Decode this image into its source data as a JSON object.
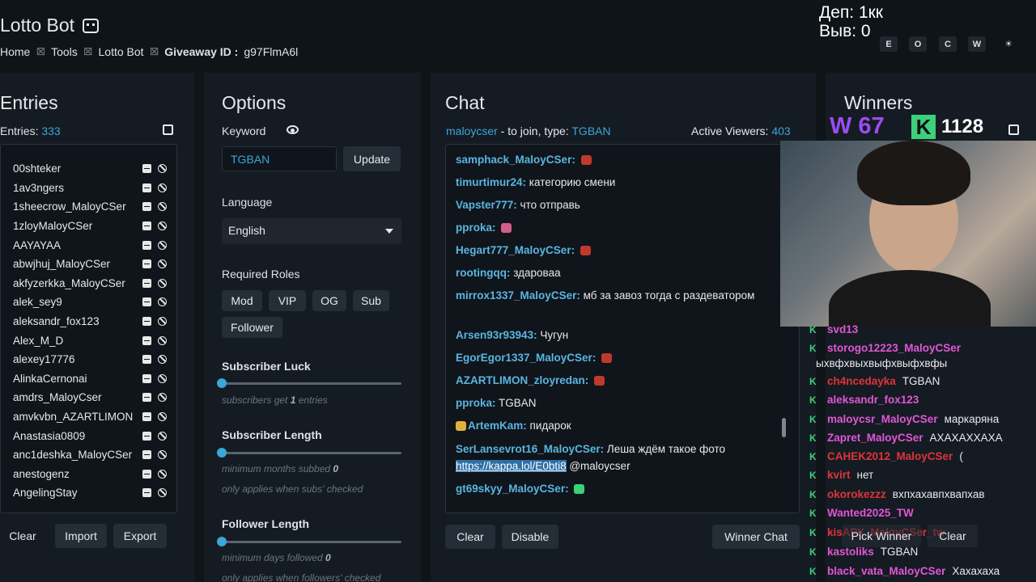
{
  "header": {
    "title": "Lotto Bot",
    "breadcrumbs": [
      "Home",
      "Tools",
      "Lotto Bot"
    ],
    "giveaway_label": "Giveaway ID :",
    "giveaway_id": "g97FlmA6l",
    "overlay_line1": "Деп: 1кк",
    "overlay_line2": "Выв: 0",
    "buttons": [
      "E",
      "O",
      "C",
      "W",
      "☀"
    ]
  },
  "entries": {
    "title": "Entries",
    "count_label": "Entries:",
    "count": "333",
    "items": [
      "00shteker",
      "1av3ngers",
      "1sheecrow_MaloyCSer",
      "1zloyMaloyCSer",
      "AAYAYAA",
      "abwjhuj_MaloyCSer",
      "akfyzerkka_MaloyCSer",
      "alek_sey9",
      "aleksandr_fox123",
      "Alex_M_D",
      "alexey17776",
      "AlinkaCernonai",
      "amdrs_MaloyCser",
      "amvkvbn_AZARTLIMON",
      "Anastasia0809",
      "anc1deshka_MaloyCSer",
      "anestogenz",
      "AngelingStay"
    ],
    "clear": "Clear",
    "import": "Import",
    "export": "Export"
  },
  "options": {
    "title": "Options",
    "keyword_label": "Keyword",
    "keyword_value": "TGBAN",
    "update": "Update",
    "language_label": "Language",
    "language_value": "English",
    "roles_label": "Required Roles",
    "roles": [
      "Mod",
      "VIP",
      "OG",
      "Sub",
      "Follower"
    ],
    "sub_luck_label": "Subscriber Luck",
    "sub_luck_hint_a": "subscribers get ",
    "sub_luck_hint_b": "1",
    "sub_luck_hint_c": " entries",
    "sub_length_label": "Subscriber Length",
    "sub_length_hint_a": "minimum months subbed ",
    "sub_length_hint_b": "0",
    "sub_length_hint2": "only applies when subs' checked",
    "fol_length_label": "Follower Length",
    "fol_length_hint_a": "minimum days followed ",
    "fol_length_hint_b": "0",
    "fol_length_hint2": "only applies when followers' checked"
  },
  "chat": {
    "title": "Chat",
    "channel": "maloycser",
    "join_text": " - to join, type: ",
    "join_keyword": "TGBAN",
    "viewers_label": "Active Viewers:",
    "viewers": "403",
    "messages": [
      {
        "user": "samphack_MaloyCSer:",
        "text": ""
      },
      {
        "user": "timurtimur24:",
        "text": "категорию смени"
      },
      {
        "user": "Vapster777:",
        "text": "что отправь"
      },
      {
        "user": "pproka:",
        "text": ""
      },
      {
        "user": "Hegart777_MaloyCSer:",
        "text": ""
      },
      {
        "user": "rootingqq:",
        "text": "здароваа"
      },
      {
        "user": "mirrox1337_MaloyCSer:",
        "text": "мб за завоз тогда с раздеватором"
      },
      {
        "user": "Arsen93r93943:",
        "text": "Чугун"
      },
      {
        "user": "EgorEgor1337_MaloyCSer:",
        "text": ""
      },
      {
        "user": "AZARTLIMON_zloyredan:",
        "text": ""
      },
      {
        "user": "pproka:",
        "text": "TGBAN"
      },
      {
        "user": "ArtemKam:",
        "text": "пидарок"
      },
      {
        "user": "SerLansevrot16_MaloyCSer:",
        "text": "Леша ждём такое фото"
      },
      {
        "user": "gt69skyy_MaloyCSer:",
        "text": ""
      }
    ],
    "link": "https://kappa.lol/E0bti8",
    "link_after": " @maloycser",
    "clear": "Clear",
    "disable": "Disable",
    "winner_chat": "Winner Chat"
  },
  "winners": {
    "title": "Winners",
    "overlay_w": "W 67",
    "overlay_k_icon": "K",
    "overlay_num": "1128",
    "rows": [
      {
        "user": "svd13",
        "text": "",
        "c": "pink"
      },
      {
        "user": "storogo12223_MaloyCSer",
        "text": "",
        "c": "pink"
      },
      {
        "user": "",
        "text": "ыхвфхвыхвыфхвыфхвфы",
        "c": "pink"
      },
      {
        "user": "ch4ncedayka",
        "text": "TGBAN",
        "c": "red"
      },
      {
        "user": "aleksandr_fox123",
        "text": "",
        "c": "pink"
      },
      {
        "user": "maloycsr_MaloyCSer",
        "text": "маркаряна",
        "c": "pink"
      },
      {
        "user": "Zapret_MaloyCSer",
        "text": "АХАХАХХАХА",
        "c": "pink"
      },
      {
        "user": "CAHEK2012_MaloyCSer",
        "text": "(",
        "c": "red"
      },
      {
        "user": "kvirt",
        "text": "нет",
        "c": "red"
      },
      {
        "user": "okorokezzz",
        "text": "вхпхахавпхвапхав",
        "c": "red"
      },
      {
        "user": "Wanted2025_TW",
        "text": "",
        "c": "pink"
      },
      {
        "user": "kisАРК_MaloyCSer_tw",
        "text": "",
        "c": "red"
      },
      {
        "user": "kastoliks",
        "text": "TGBAN",
        "c": "pink"
      },
      {
        "user": "black_vata_MaloyCSer",
        "text": "Хахахаха",
        "c": "pink"
      }
    ],
    "pick_winner": "Pick Winner",
    "clear": "Clear"
  },
  "colors": {
    "accent": "#3aa6d9",
    "bg": "#0f1419",
    "panel": "#151b22"
  }
}
